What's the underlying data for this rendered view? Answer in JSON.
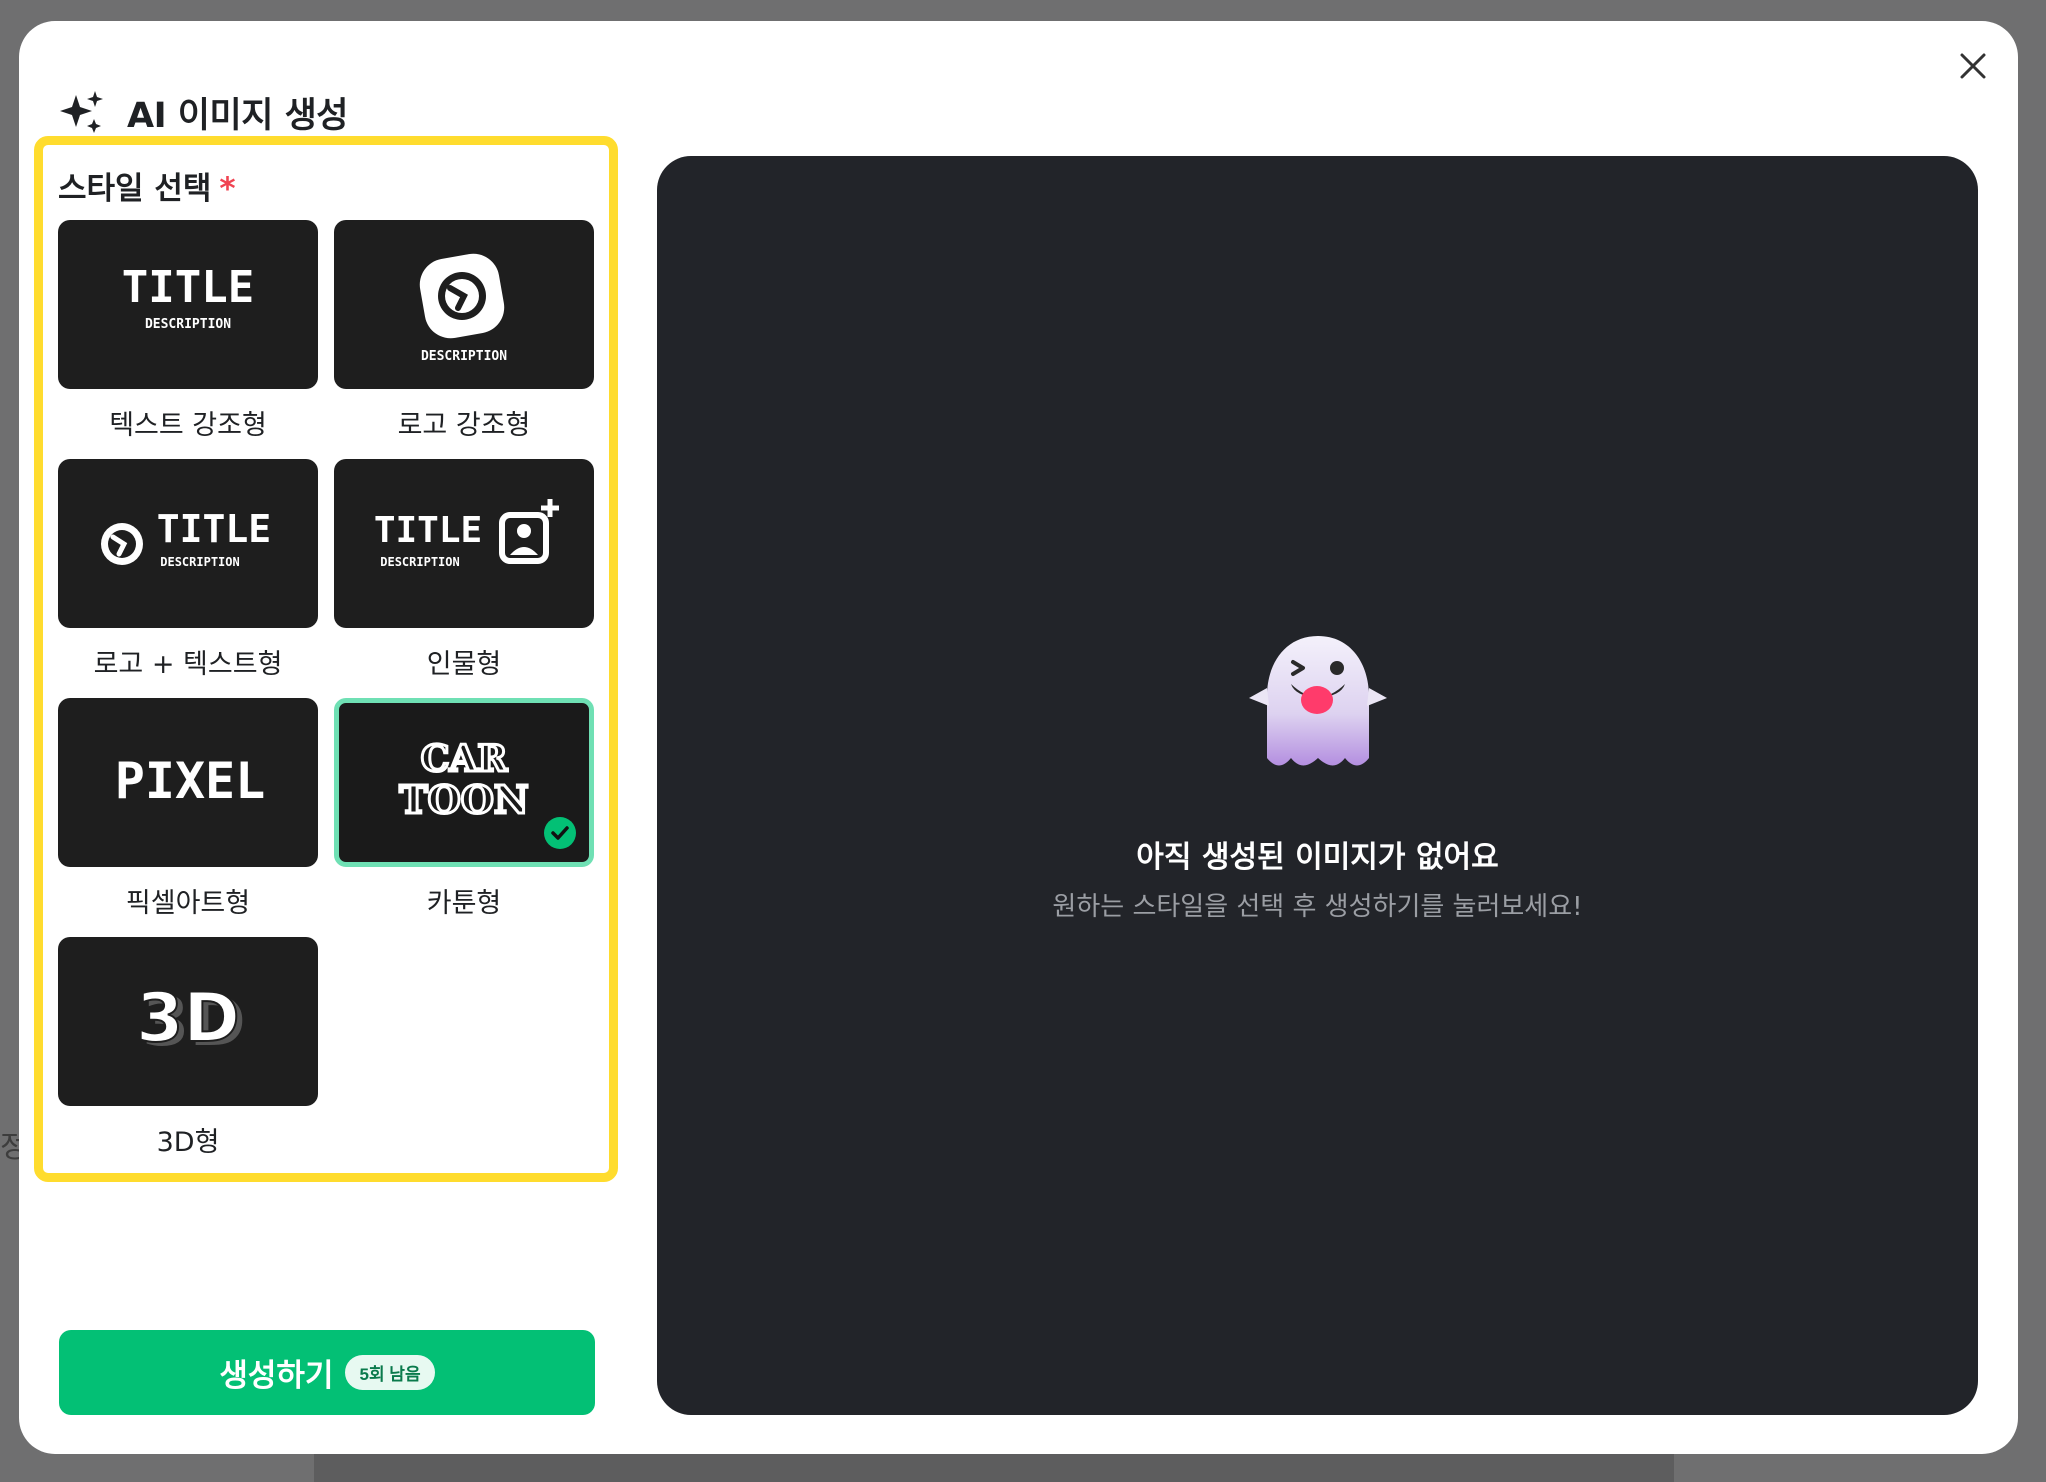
{
  "modal": {
    "title": "AI 이미지 생성"
  },
  "style_section": {
    "title": "스타일 선택",
    "required_mark": "*",
    "options": [
      {
        "label": "텍스트 강조형",
        "thumb_text": "TITLE",
        "thumb_sub": "DESCRIPTION",
        "selected": false
      },
      {
        "label": "로고 강조형",
        "thumb_sub": "DESCRIPTION",
        "selected": false
      },
      {
        "label": "로고 + 텍스트형",
        "thumb_text": "TITLE",
        "thumb_sub": "DESCRIPTION",
        "selected": false
      },
      {
        "label": "인물형",
        "thumb_text": "TITLE",
        "thumb_sub": "DESCRIPTION",
        "selected": false
      },
      {
        "label": "픽셀아트형",
        "thumb_text": "PIXEL",
        "selected": false
      },
      {
        "label": "카툰형",
        "thumb_text": "CAR",
        "thumb_text2": "TOON",
        "selected": true
      },
      {
        "label": "3D형",
        "thumb_text": "3D",
        "selected": false
      }
    ]
  },
  "generate": {
    "label": "생성하기",
    "badge": "5회 남음"
  },
  "preview": {
    "empty_title": "아직 생성된 이미지가 없어요",
    "empty_desc": "원하는 스타일을 선택 후 생성하기를 눌러보세요!"
  },
  "background": {
    "partial_char": "정"
  },
  "colors": {
    "accent_green": "#03c075",
    "highlight_yellow": "#ffdc2e",
    "required_red": "#f04452",
    "preview_bg": "#222429"
  }
}
